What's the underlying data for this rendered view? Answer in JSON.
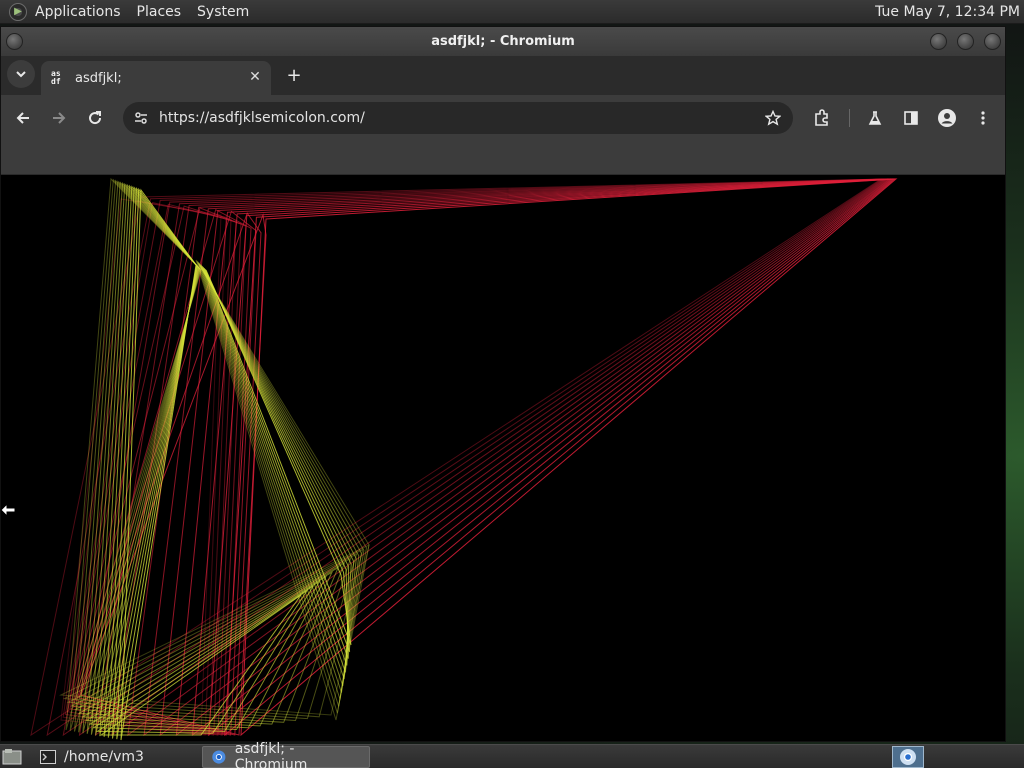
{
  "top_panel": {
    "menus": [
      "Applications",
      "Places",
      "System"
    ],
    "clock": "Tue May  7, 12:34 PM"
  },
  "window": {
    "title": "asdfjkl; - Chromium"
  },
  "tab": {
    "favicon_text": "as df",
    "title": "asdfjkl;",
    "close_glyph": "✕",
    "new_tab_glyph": "+"
  },
  "toolbar": {
    "url": "https://asdfjklsemicolon.com/"
  },
  "taskbar": {
    "items": [
      {
        "label": "/home/vm3",
        "icon": "terminal-icon"
      },
      {
        "label": "asdfjkl; - Chromium",
        "icon": "chromium-icon"
      }
    ]
  },
  "colors": {
    "red_lines": "#e0203a",
    "yellow_lines": "#d6e33a",
    "page_bg": "#000000"
  }
}
